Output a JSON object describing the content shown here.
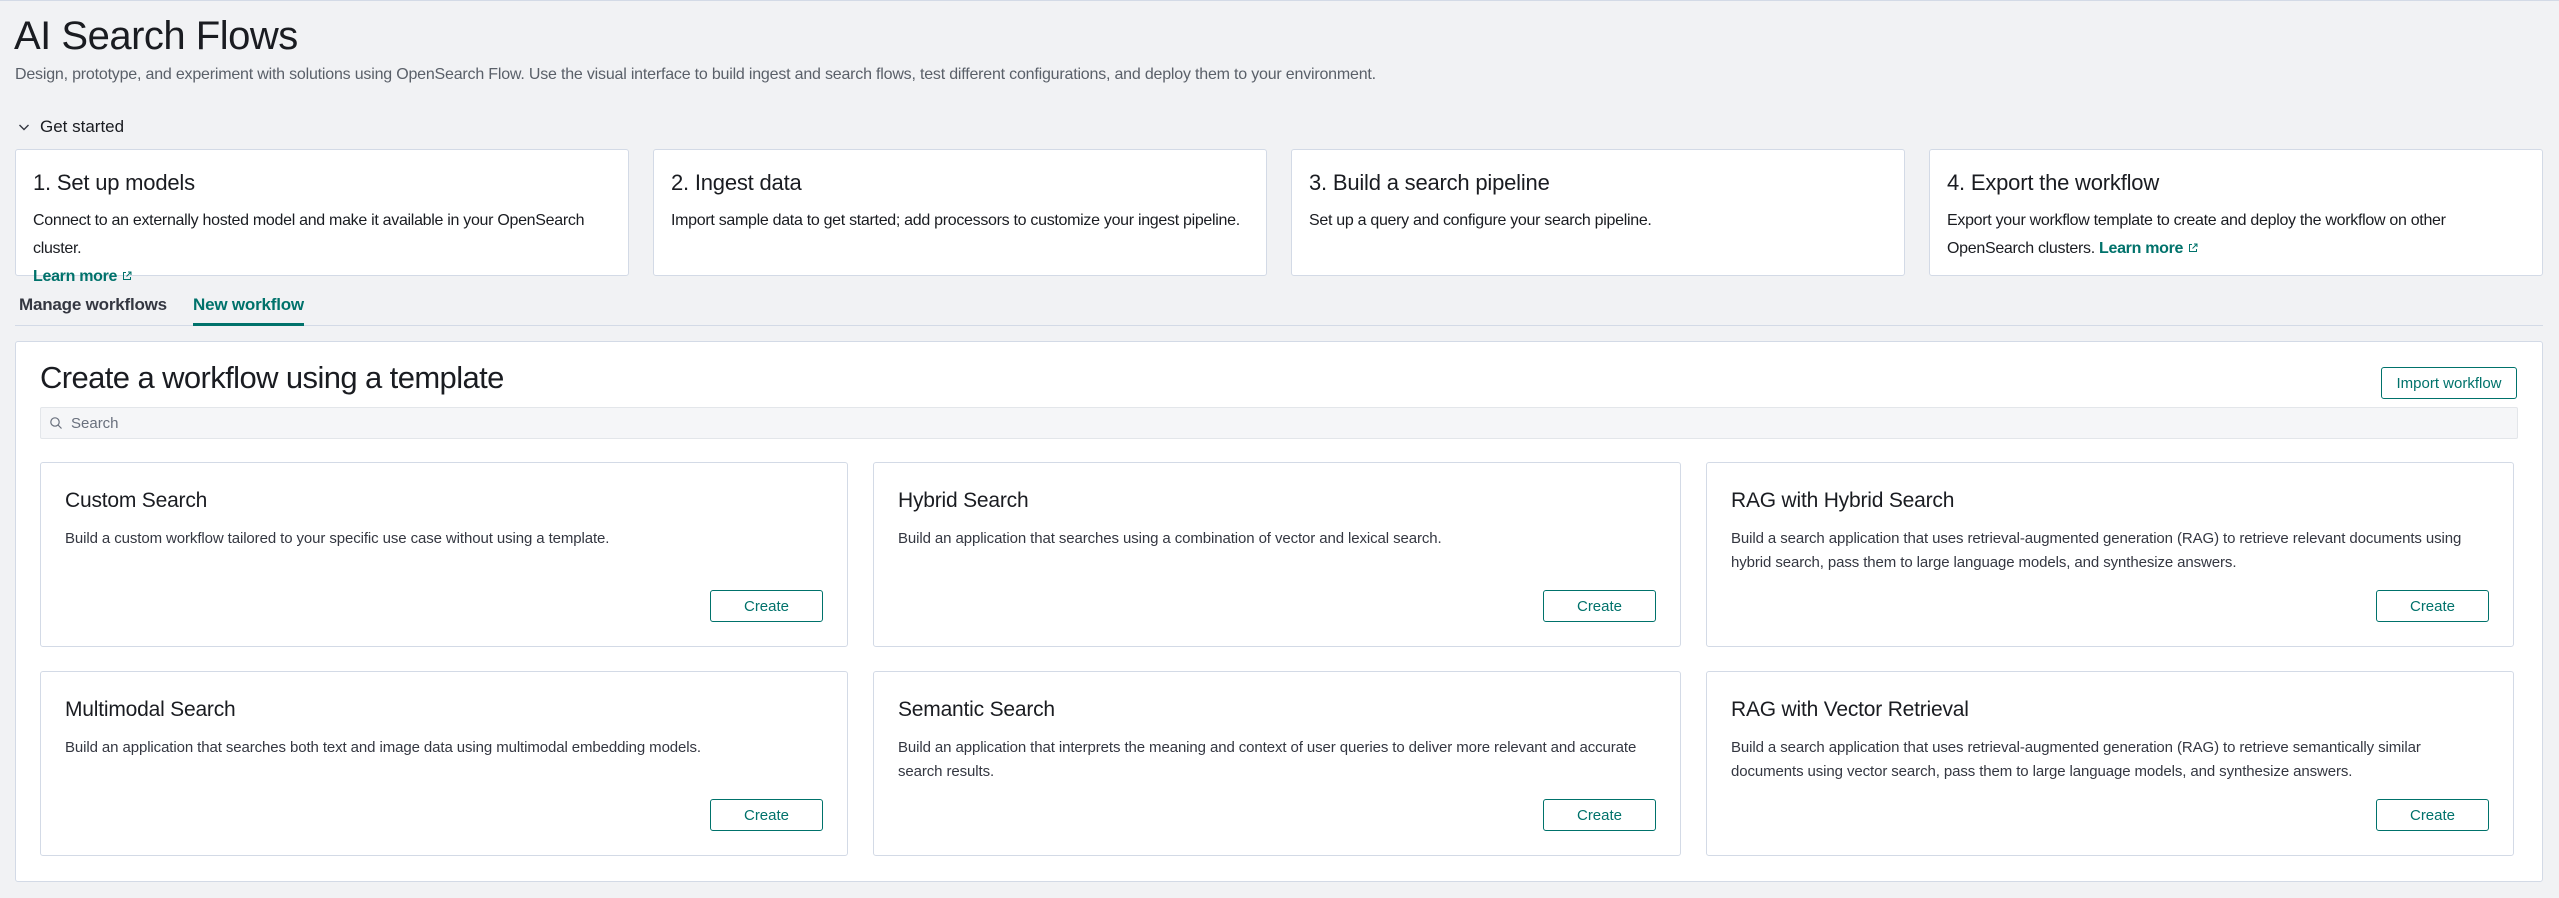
{
  "header": {
    "title": "AI Search Flows",
    "description": "Design, prototype, and experiment with solutions using OpenSearch Flow. Use the visual interface to build ingest and search flows, test different configurations, and deploy them to your environment."
  },
  "get_started": {
    "label": "Get started",
    "steps": [
      {
        "title": "1. Set up models",
        "text": "Connect to an externally hosted model and make it available in your OpenSearch cluster.",
        "link": "Learn more"
      },
      {
        "title": "2. Ingest data",
        "text": "Import sample data to get started; add processors to customize your ingest pipeline."
      },
      {
        "title": "3. Build a search pipeline",
        "text": "Set up a query and configure your search pipeline."
      },
      {
        "title": "4. Export the workflow",
        "text": "Export your workflow template to create and deploy the workflow on other OpenSearch clusters.",
        "link": "Learn more"
      }
    ]
  },
  "tabs": [
    {
      "label": "Manage workflows",
      "active": false
    },
    {
      "label": "New workflow",
      "active": true
    }
  ],
  "panel": {
    "title": "Create a workflow using a template",
    "import_label": "Import workflow",
    "search_placeholder": "Search",
    "templates": [
      {
        "title": "Custom Search",
        "desc": "Build a custom workflow tailored to your specific use case without using a template.",
        "button": "Create"
      },
      {
        "title": "Hybrid Search",
        "desc": "Build an application that searches using a combination of vector and lexical search.",
        "button": "Create"
      },
      {
        "title": "RAG with Hybrid Search",
        "desc": "Build a search application that uses retrieval-augmented generation (RAG) to retrieve relevant documents using hybrid search, pass them to large language models, and synthesize answers.",
        "button": "Create"
      },
      {
        "title": "Multimodal Search",
        "desc": "Build an application that searches both text and image data using multimodal embedding models.",
        "button": "Create"
      },
      {
        "title": "Semantic Search",
        "desc": "Build an application that interprets the meaning and context of user queries to deliver more relevant and accurate search results.",
        "button": "Create"
      },
      {
        "title": "RAG with Vector Retrieval",
        "desc": "Build a search application that uses retrieval-augmented generation (RAG) to retrieve semantically similar documents using vector search, pass them to large language models, and synthesize answers.",
        "button": "Create"
      }
    ]
  },
  "colors": {
    "accent": "#00726b",
    "background": "#f1f2f4",
    "border": "#d3dae6"
  },
  "icons": {
    "get_started_toggle": "chevron-down-icon",
    "search": "search-icon",
    "external_link": "external-link-icon"
  }
}
